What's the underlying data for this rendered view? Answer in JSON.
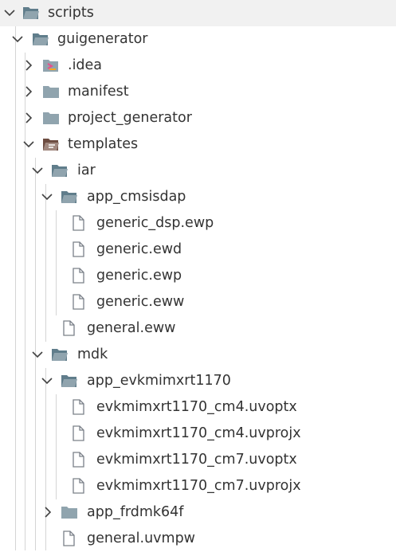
{
  "explorer": {
    "scripts": {
      "label": "scripts",
      "icon": "folder-open-icon",
      "state": "expanded"
    },
    "guigenerator": {
      "label": "guigenerator",
      "icon": "folder-open-icon",
      "state": "expanded"
    },
    "idea": {
      "label": ".idea",
      "icon": "idea-folder-icon",
      "state": "collapsed"
    },
    "manifest": {
      "label": "manifest",
      "icon": "folder-icon",
      "state": "collapsed"
    },
    "project_generator": {
      "label": "project_generator",
      "icon": "folder-icon",
      "state": "collapsed"
    },
    "templates": {
      "label": "templates",
      "icon": "templates-folder-open-icon",
      "state": "expanded"
    },
    "iar": {
      "label": "iar",
      "icon": "folder-open-icon",
      "state": "expanded"
    },
    "app_cmsisdap": {
      "label": "app_cmsisdap",
      "icon": "folder-open-icon",
      "state": "expanded"
    },
    "generic_dsp_ewp": {
      "label": "generic_dsp.ewp",
      "icon": "file-icon"
    },
    "generic_ewd": {
      "label": "generic.ewd",
      "icon": "file-icon"
    },
    "generic_ewp": {
      "label": "generic.ewp",
      "icon": "file-icon"
    },
    "generic_eww": {
      "label": "generic.eww",
      "icon": "file-icon"
    },
    "general_eww": {
      "label": "general.eww",
      "icon": "file-icon"
    },
    "mdk": {
      "label": "mdk",
      "icon": "folder-open-icon",
      "state": "expanded"
    },
    "app_evkmimxrt1170": {
      "label": "app_evkmimxrt1170",
      "icon": "folder-open-icon",
      "state": "expanded"
    },
    "cm4_uvoptx": {
      "label": "evkmimxrt1170_cm4.uvoptx",
      "icon": "file-icon"
    },
    "cm4_uvprojx": {
      "label": "evkmimxrt1170_cm4.uvprojx",
      "icon": "file-icon"
    },
    "cm7_uvoptx": {
      "label": "evkmimxrt1170_cm7.uvoptx",
      "icon": "file-icon"
    },
    "cm7_uvprojx": {
      "label": "evkmimxrt1170_cm7.uvprojx",
      "icon": "file-icon"
    },
    "app_frdmk64f": {
      "label": "app_frdmk64f",
      "icon": "folder-icon",
      "state": "collapsed"
    },
    "general_uvmpw": {
      "label": "general.uvmpw",
      "icon": "file-icon"
    }
  },
  "colors": {
    "folder": "#90a4ae",
    "folder_dark": "#607d8b",
    "templates_folder": "#8d6e63",
    "idea_accent": "#e94f8a",
    "idea_accent2": "#f5a623",
    "file_outline": "#7a8088",
    "text": "#333333",
    "guide": "#d5d5d5",
    "selected_row": "#f1f1f1"
  }
}
